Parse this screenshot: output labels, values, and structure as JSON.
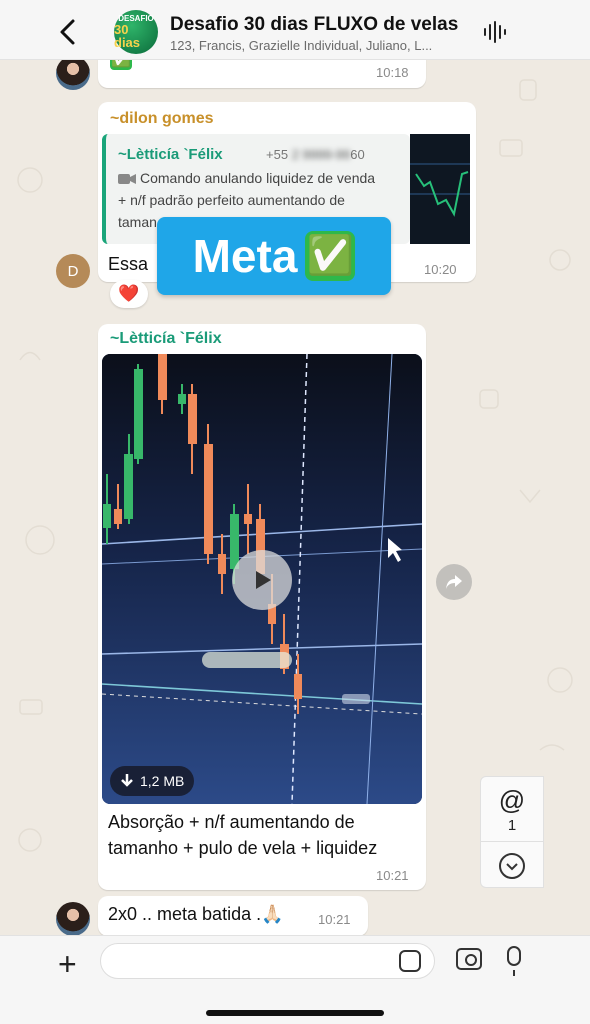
{
  "header": {
    "back_label": "Back",
    "group_title": "Desafio 30 dias FLUXO de velas",
    "members": "123, Francis, Grazielle Individual, Juliano, L...",
    "avatar_line1": "DESAFIO",
    "avatar_line2": "30 dias"
  },
  "messages": {
    "m1": {
      "content": "✅",
      "time": "10:18"
    },
    "m2": {
      "sender": "~dilon gomes",
      "sender_color": "#c8902a",
      "quote_sender": "~Lètticía `Félix",
      "quote_phone": "+55",
      "quote_phone_tail": "60",
      "quote_line1": "Comando anulando liquidez de venda",
      "quote_line2": "+ n/f padrão perfeito aumentando de",
      "quote_line3": "taman",
      "text": "Essa",
      "time": "10:20",
      "avatar_letter": "D",
      "sticker_text": "Meta",
      "sticker_check": "✅",
      "reaction": "❤️"
    },
    "m3": {
      "sender": "~Lètticía `Félix",
      "sender_color": "#1a9b78",
      "video_size": "1,2 MB",
      "caption_line1": "Absorção + n/f aumentando de",
      "caption_line2": "tamanho + pulo de vela + liquidez",
      "time": "10:21"
    },
    "m4": {
      "text": "2x0 .. meta batida .🙏🏻",
      "time": "10:21"
    }
  },
  "side_panel": {
    "mention_symbol": "@",
    "mention_count": "1"
  },
  "icons": [
    "back-chevron-icon",
    "audio-wave-icon",
    "video-camera-icon",
    "play-icon",
    "download-icon",
    "forward-icon",
    "chevron-down-icon",
    "plus-icon",
    "sticker-icon",
    "camera-icon",
    "microphone-icon"
  ],
  "colors": {
    "accent_green": "#1aa57a",
    "sticker_blue": "#1fa6e8",
    "heart_red": "#e0233b"
  }
}
